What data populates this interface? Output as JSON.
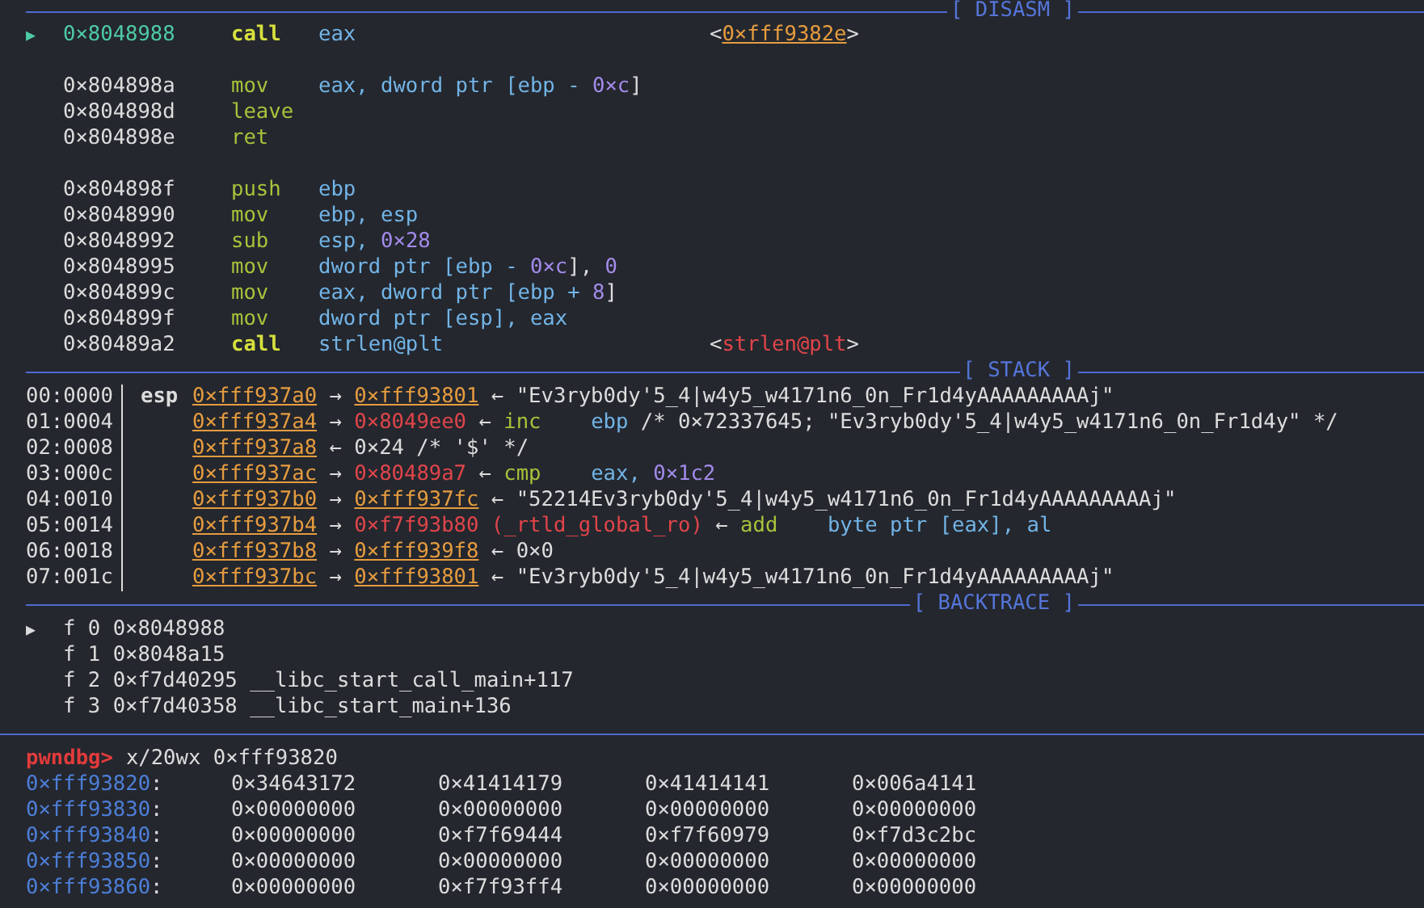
{
  "disasm": {
    "header": "[ DISASM ]",
    "blocks": [
      [
        {
          "current": true,
          "marker": "▶",
          "address": "0×8048988",
          "mnemonic": "call",
          "operands": [
            {
              "text": "eax",
              "kind": "reg"
            }
          ],
          "annotation": [
            {
              "text": "<",
              "kind": "plain"
            },
            {
              "text": "0×fff9382e",
              "kind": "stack"
            },
            {
              "text": ">",
              "kind": "plain"
            }
          ]
        }
      ],
      [
        {
          "current": false,
          "address": "0×804898a",
          "mnemonic": "mov",
          "operands": [
            {
              "text": "eax, dword ptr [ebp - ",
              "kind": "reg"
            },
            {
              "text": "0×c",
              "kind": "num"
            },
            {
              "text": "]",
              "kind": "plain"
            }
          ]
        },
        {
          "current": false,
          "address": "0×804898d",
          "mnemonic": "leave"
        },
        {
          "current": false,
          "address": "0×804898e",
          "mnemonic": "ret"
        }
      ],
      [
        {
          "current": false,
          "address": "0×804898f",
          "mnemonic": "push",
          "operands": [
            {
              "text": "ebp",
              "kind": "reg"
            }
          ]
        },
        {
          "current": false,
          "address": "0×8048990",
          "mnemonic": "mov",
          "operands": [
            {
              "text": "ebp, esp",
              "kind": "reg"
            }
          ]
        },
        {
          "current": false,
          "address": "0×8048992",
          "mnemonic": "sub",
          "operands": [
            {
              "text": "esp, ",
              "kind": "reg"
            },
            {
              "text": "0×28",
              "kind": "num"
            }
          ]
        },
        {
          "current": false,
          "address": "0×8048995",
          "mnemonic": "mov",
          "operands": [
            {
              "text": "dword ptr [ebp - ",
              "kind": "reg"
            },
            {
              "text": "0×c",
              "kind": "num"
            },
            {
              "text": "], ",
              "kind": "plain"
            },
            {
              "text": "0",
              "kind": "num"
            }
          ]
        },
        {
          "current": false,
          "address": "0×804899c",
          "mnemonic": "mov",
          "operands": [
            {
              "text": "eax, dword ptr [ebp + ",
              "kind": "reg"
            },
            {
              "text": "8",
              "kind": "num"
            },
            {
              "text": "]",
              "kind": "plain"
            }
          ]
        },
        {
          "current": false,
          "address": "0×804899f",
          "mnemonic": "mov",
          "operands": [
            {
              "text": "dword ptr [esp], eax",
              "kind": "reg"
            }
          ]
        },
        {
          "current": false,
          "address": "0×80489a2",
          "mnemonic": "call",
          "operands": [
            {
              "text": "strlen@plt",
              "kind": "reg"
            }
          ],
          "annotation": [
            {
              "text": "<",
              "kind": "plain"
            },
            {
              "text": "strlen@plt",
              "kind": "code"
            },
            {
              "text": ">",
              "kind": "plain"
            }
          ]
        }
      ]
    ]
  },
  "stack": {
    "header": "[ STACK ]",
    "rows": [
      {
        "index": "00:0000",
        "register": "esp",
        "chain": [
          {
            "text": "0×fff937a0",
            "kind": "stack"
          },
          {
            "text": " → ",
            "kind": "plain"
          },
          {
            "text": "0×fff93801",
            "kind": "stack"
          },
          {
            "text": " ← \"Ev3ryb0dy'5_4|w4y5_w4171n6_0n_Fr1d4yAAAAAAAAAj\"",
            "kind": "plain"
          }
        ]
      },
      {
        "index": "01:0004",
        "chain": [
          {
            "text": "0×fff937a4",
            "kind": "stack"
          },
          {
            "text": " → ",
            "kind": "plain"
          },
          {
            "text": "0×8049ee0",
            "kind": "code"
          },
          {
            "text": " ← ",
            "kind": "plain"
          },
          {
            "text": "inc",
            "kind": "mnem"
          },
          {
            "text": "ebp",
            "kind": "reg"
          },
          {
            "text": " /* 0×72337645; \"Ev3ryb0dy'5_4|w4y5_w4171n6_0n_Fr1d4y\" */",
            "kind": "plain"
          }
        ]
      },
      {
        "index": "02:0008",
        "chain": [
          {
            "text": "0×fff937a8",
            "kind": "stack"
          },
          {
            "text": " ← 0×24 /* '$' */",
            "kind": "plain"
          }
        ]
      },
      {
        "index": "03:000c",
        "chain": [
          {
            "text": "0×fff937ac",
            "kind": "stack"
          },
          {
            "text": " → ",
            "kind": "plain"
          },
          {
            "text": "0×80489a7",
            "kind": "code"
          },
          {
            "text": " ← ",
            "kind": "plain"
          },
          {
            "text": "cmp",
            "kind": "mnem"
          },
          {
            "text": "eax, ",
            "kind": "reg"
          },
          {
            "text": "0×1c2",
            "kind": "num"
          }
        ]
      },
      {
        "index": "04:0010",
        "chain": [
          {
            "text": "0×fff937b0",
            "kind": "stack"
          },
          {
            "text": " → ",
            "kind": "plain"
          },
          {
            "text": "0×fff937fc",
            "kind": "stack"
          },
          {
            "text": " ← \"52214Ev3ryb0dy'5_4|w4y5_w4171n6_0n_Fr1d4yAAAAAAAAAj\"",
            "kind": "plain"
          }
        ]
      },
      {
        "index": "05:0014",
        "chain": [
          {
            "text": "0×fff937b4",
            "kind": "stack"
          },
          {
            "text": " → ",
            "kind": "plain"
          },
          {
            "text": "0×f7f93b80 (_rtld_global_ro)",
            "kind": "code"
          },
          {
            "text": " ← ",
            "kind": "plain"
          },
          {
            "text": "add",
            "kind": "mnem"
          },
          {
            "text": "byte ptr [eax], al",
            "kind": "reg"
          }
        ]
      },
      {
        "index": "06:0018",
        "chain": [
          {
            "text": "0×fff937b8",
            "kind": "stack"
          },
          {
            "text": " → ",
            "kind": "plain"
          },
          {
            "text": "0×fff939f8",
            "kind": "stack"
          },
          {
            "text": " ← 0×0",
            "kind": "plain"
          }
        ]
      },
      {
        "index": "07:001c",
        "chain": [
          {
            "text": "0×fff937bc",
            "kind": "stack"
          },
          {
            "text": " → ",
            "kind": "plain"
          },
          {
            "text": "0×fff93801",
            "kind": "stack"
          },
          {
            "text": " ← \"Ev3ryb0dy'5_4|w4y5_w4171n6_0n_Fr1d4yAAAAAAAAAj\"",
            "kind": "plain"
          }
        ]
      }
    ]
  },
  "backtrace": {
    "header": "[ BACKTRACE ]",
    "frames": [
      {
        "marker": "▶",
        "text": "f 0 0×8048988"
      },
      {
        "text": "f 1 0×8048a15"
      },
      {
        "text": "f 2 0×f7d40295 __libc_start_call_main+117"
      },
      {
        "text": "f 3 0×f7d40358 __libc_start_main+136"
      }
    ]
  },
  "console": {
    "prompt": "pwndbg>",
    "command": "x/20wx 0×fff93820",
    "rows": [
      {
        "address": "0×fff93820",
        "colon": ":",
        "values": [
          "0×34643172",
          "0×41414179",
          "0×41414141",
          "0×006a4141"
        ]
      },
      {
        "address": "0×fff93830",
        "colon": ":",
        "values": [
          "0×00000000",
          "0×00000000",
          "0×00000000",
          "0×00000000"
        ]
      },
      {
        "address": "0×fff93840",
        "colon": ":",
        "values": [
          "0×00000000",
          "0×f7f69444",
          "0×f7f60979",
          "0×f7d3c2bc"
        ]
      },
      {
        "address": "0×fff93850",
        "colon": ":",
        "values": [
          "0×00000000",
          "0×00000000",
          "0×00000000",
          "0×00000000"
        ]
      },
      {
        "address": "0×fff93860",
        "colon": ":",
        "values": [
          "0×00000000",
          "0×f7f93ff4",
          "0×00000000",
          "0×00000000"
        ]
      }
    ]
  }
}
